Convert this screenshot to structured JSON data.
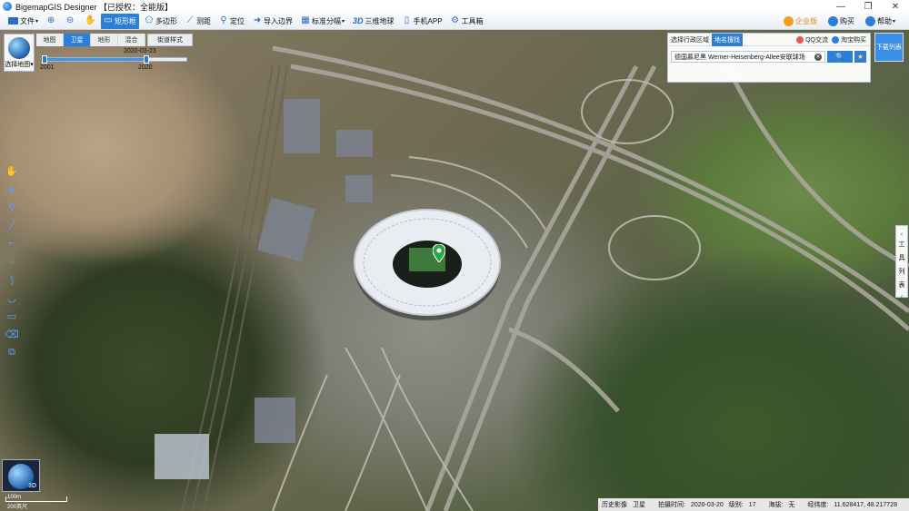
{
  "window": {
    "title": "BigemapGIS Designer 【已授权：全能版】",
    "controls": [
      "—",
      "❐",
      "✕"
    ]
  },
  "toolbar": {
    "items": [
      {
        "label": "文件",
        "icon": "folder-icon"
      },
      {
        "label": "",
        "icon": "zoom-in-icon"
      },
      {
        "label": "",
        "icon": "zoom-out-icon"
      },
      {
        "label": "",
        "icon": "hand-icon"
      },
      {
        "label": "矩形框",
        "icon": "rectangle-select-icon",
        "active": true
      },
      {
        "label": "多边形",
        "icon": "polygon-icon"
      },
      {
        "label": "测距",
        "icon": "ruler-icon"
      },
      {
        "label": "定位",
        "icon": "location-pin-icon"
      },
      {
        "label": "导入边界",
        "icon": "import-boundary-icon"
      },
      {
        "label": "标准分幅",
        "icon": "grid-icon"
      },
      {
        "label": "三维地球",
        "icon": "3d-icon"
      },
      {
        "label": "手机APP",
        "icon": "phone-icon"
      },
      {
        "label": "工具箱",
        "icon": "gear-icon"
      }
    ],
    "right": [
      {
        "label": "企业版",
        "icon": "enterprise-icon",
        "color": "#f0a020"
      },
      {
        "label": "购买",
        "icon": "buy-icon",
        "color": "#2b7fd8"
      },
      {
        "label": "帮助",
        "icon": "help-icon",
        "color": "#2b7fd8"
      }
    ]
  },
  "map": {
    "selector_label": "选择地图",
    "tabs": [
      "地图",
      "卫星",
      "地形",
      "混合"
    ],
    "active_tab": "卫星",
    "street_style": "街道样式",
    "timeline": {
      "date": "2020-03-23",
      "start_year": "2001",
      "end_year": "2020"
    },
    "mini_globe_tag": "3D",
    "scale": {
      "top": "100m",
      "bottom": "200英尺"
    }
  },
  "search": {
    "tabs": [
      "选择行政区域",
      "地名搜找"
    ],
    "active_tab": "地名搜找",
    "links": [
      {
        "label": "QQ交流",
        "color": "#e55"
      },
      {
        "label": "淘宝购买",
        "color": "#2b7fd8"
      }
    ],
    "value": "德国慕尼黑 Werner-Heisenberg-Allee安联球场",
    "clear": "✕",
    "search_icon": "🔍",
    "star_icon": "★"
  },
  "download_button": "下载列表",
  "tool_list": {
    "label": [
      "工",
      "具",
      "列",
      "表"
    ],
    "arrows": [
      "‹",
      "‹"
    ]
  },
  "status": {
    "history": "历史影像",
    "type": "卫星",
    "capture_label": "拍摄时间:",
    "capture_date": "2020-03-20",
    "level_label": "级别:",
    "level": "17",
    "altitude_label": "海拔:",
    "altitude": "无",
    "coord_label": "经纬度:",
    "coords": "11.628417, 48.217728"
  },
  "colors": {
    "accent": "#2b7fd8",
    "marker": "#2aa84a"
  }
}
